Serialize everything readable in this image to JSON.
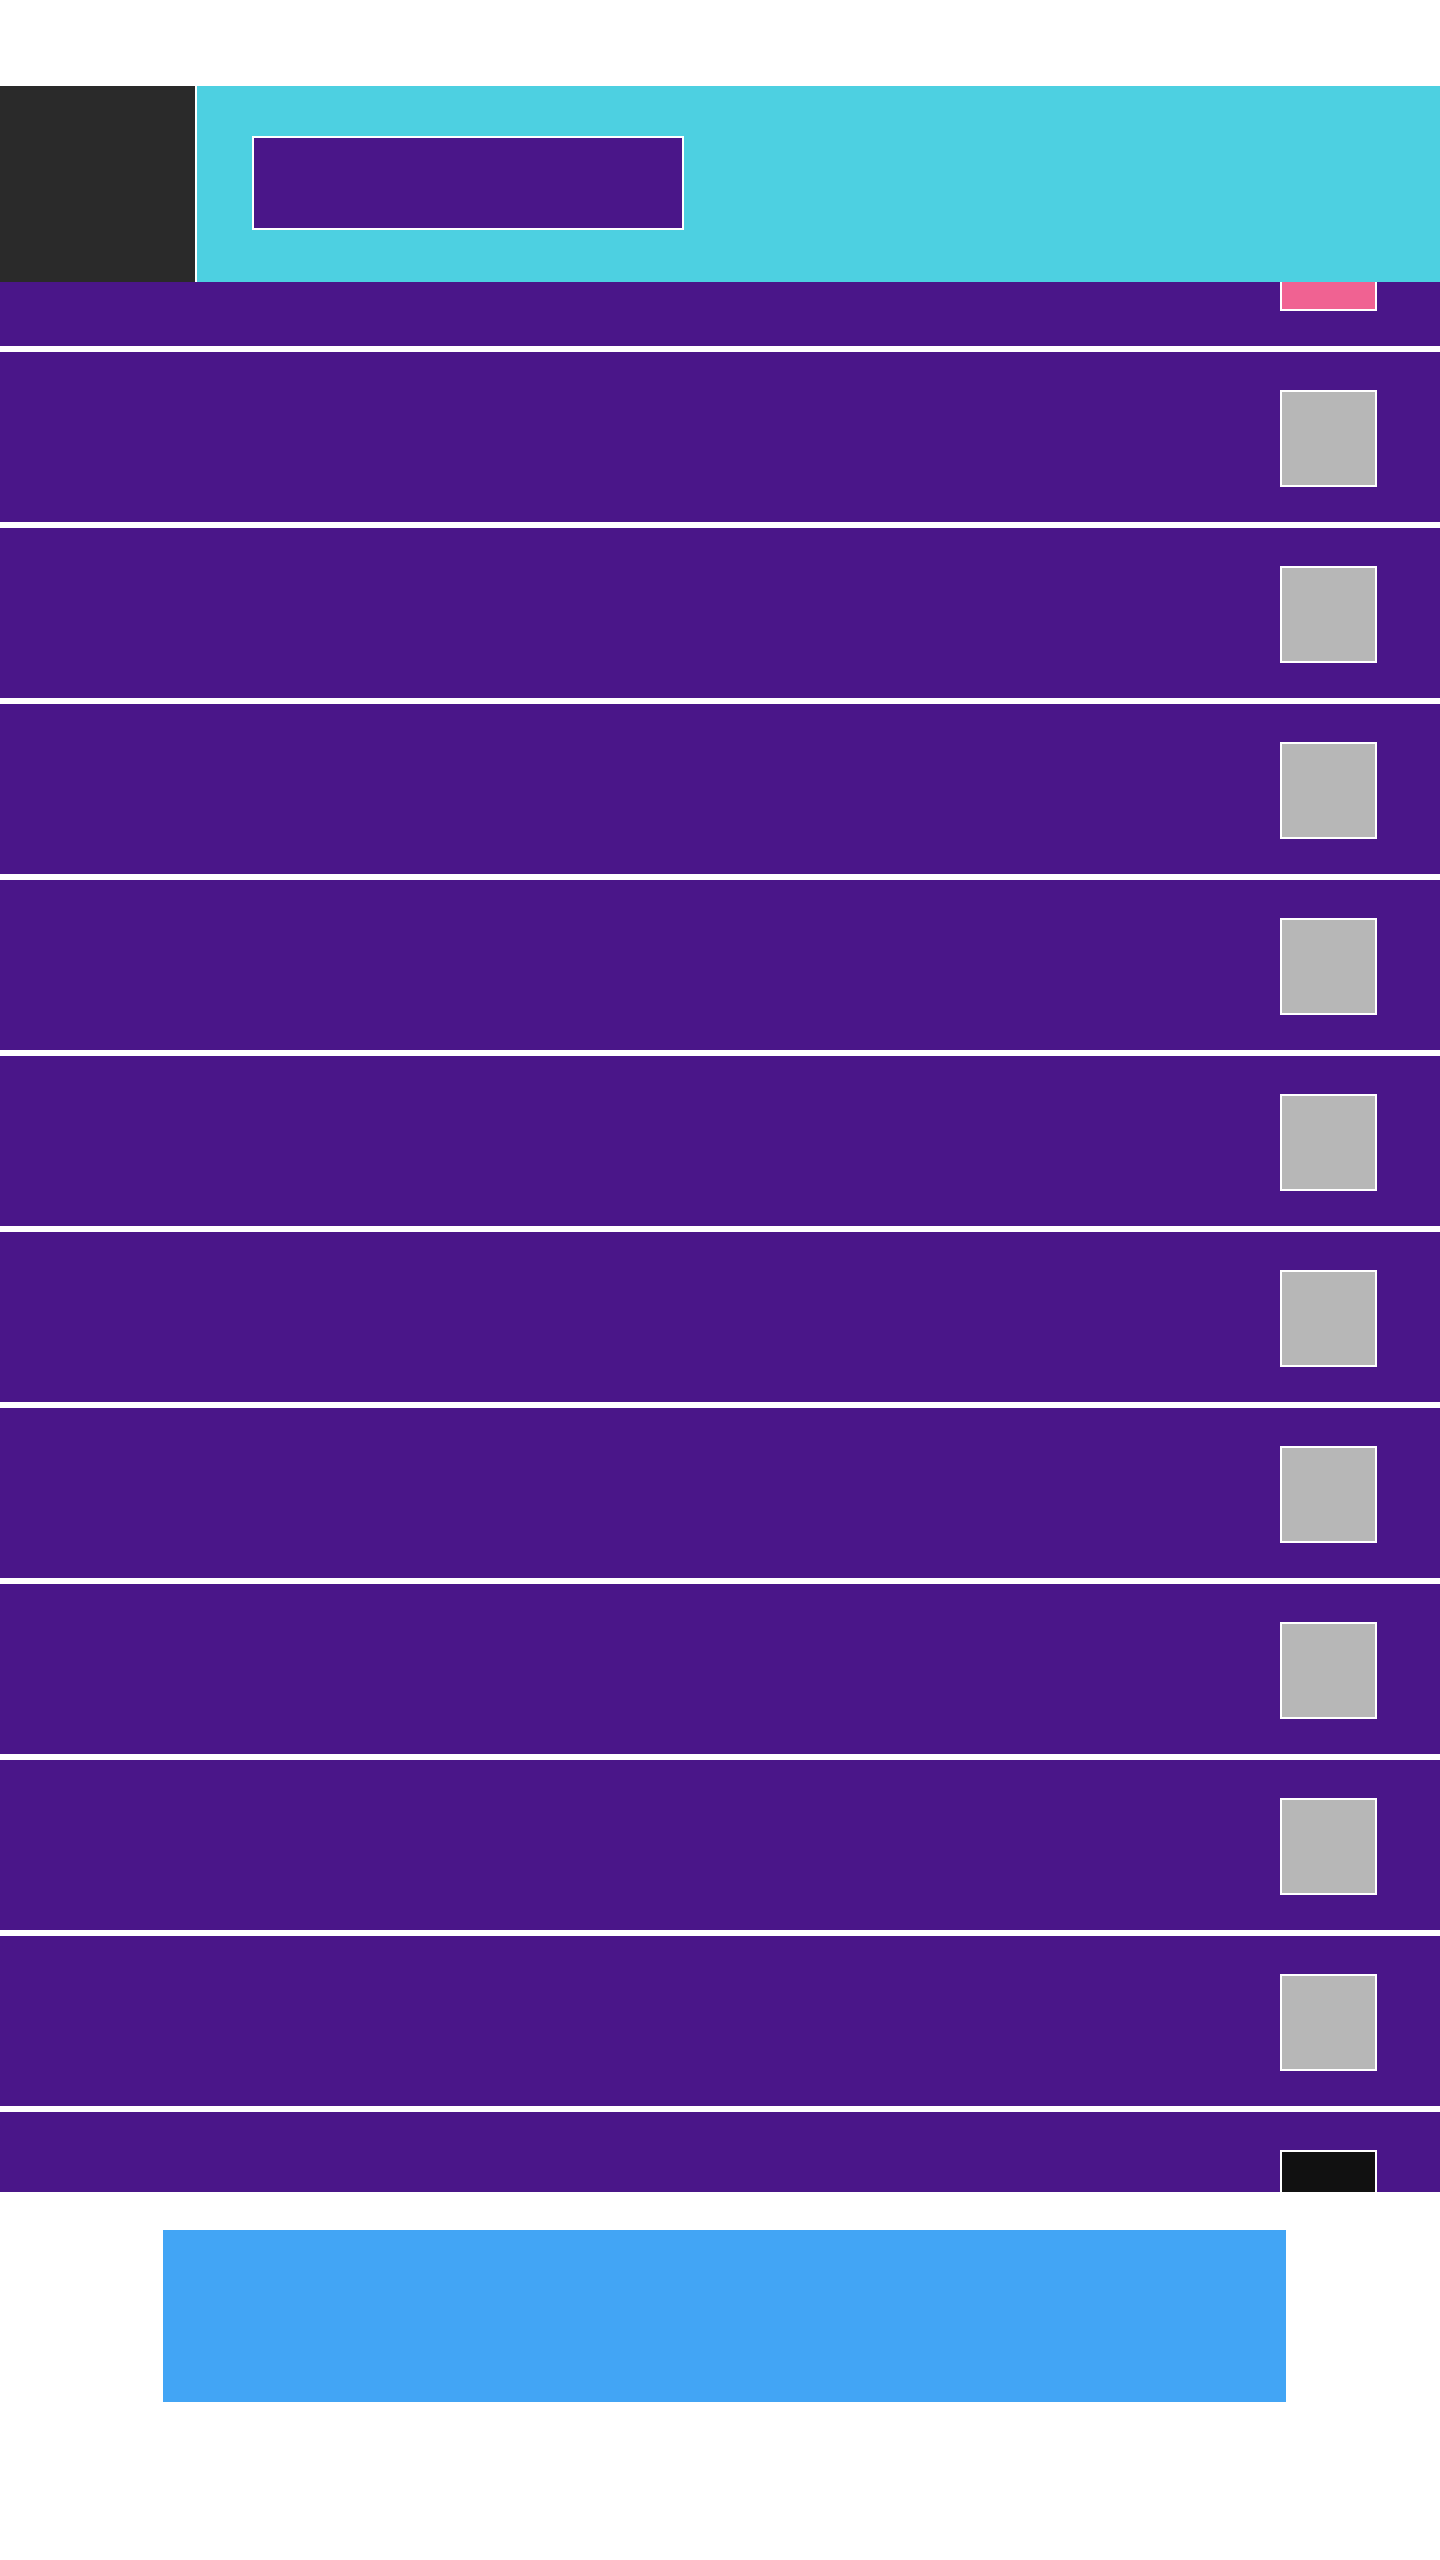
{
  "colors": {
    "page_background": "#ffffff",
    "header_left_block": "#2a2a2a",
    "header_background": "#4dd0e1",
    "header_field": "#4a1689",
    "row_background": "#4a1689",
    "row_divider": "#ffffff",
    "thumb_first": "#f06292",
    "thumb_default": "#b7b7b7",
    "thumb_last": "#111111",
    "bottom_button": "#42a5f5"
  },
  "header": {
    "field_text": ""
  },
  "list": {
    "items": [
      {
        "label": "",
        "thumb": "thumb_first"
      },
      {
        "label": "",
        "thumb": "thumb_default"
      },
      {
        "label": "",
        "thumb": "thumb_default"
      },
      {
        "label": "",
        "thumb": "thumb_default"
      },
      {
        "label": "",
        "thumb": "thumb_default"
      },
      {
        "label": "",
        "thumb": "thumb_default"
      },
      {
        "label": "",
        "thumb": "thumb_default"
      },
      {
        "label": "",
        "thumb": "thumb_default"
      },
      {
        "label": "",
        "thumb": "thumb_default"
      },
      {
        "label": "",
        "thumb": "thumb_default"
      },
      {
        "label": "",
        "thumb": "thumb_default"
      },
      {
        "label": "",
        "thumb": "thumb_last"
      }
    ]
  },
  "bottom_button": {
    "label": ""
  }
}
